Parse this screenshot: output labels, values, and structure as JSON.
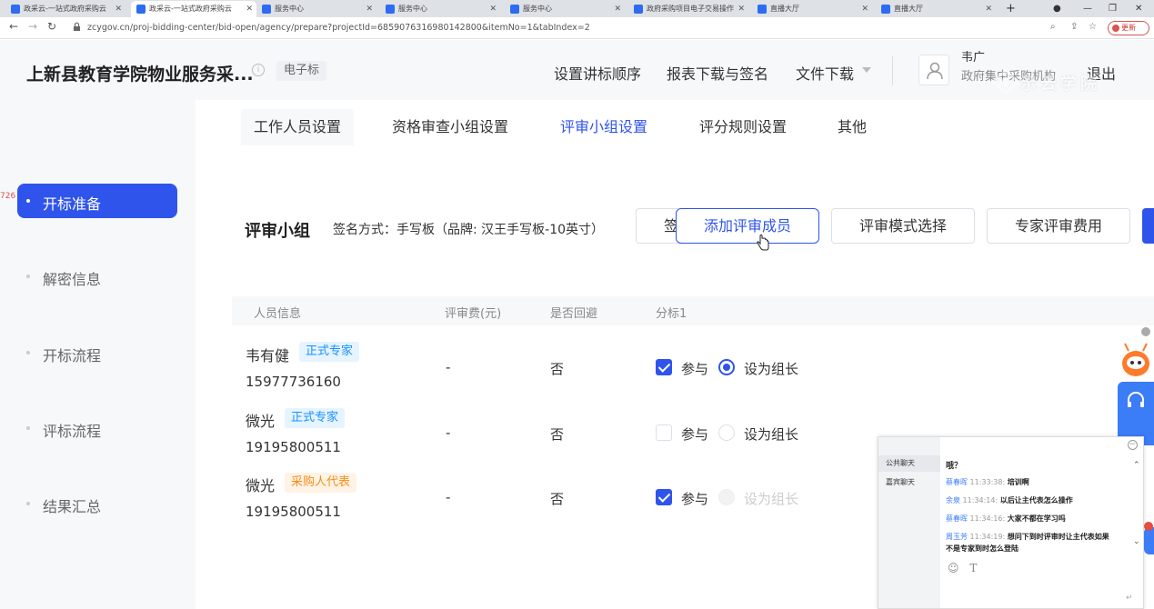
{
  "browser": {
    "tabs": [
      {
        "title": "政采云-一站式政府采购云"
      },
      {
        "title": "政采云-一站式政府采购云"
      },
      {
        "title": "服务中心"
      },
      {
        "title": "服务中心"
      },
      {
        "title": "服务中心"
      },
      {
        "title": "政府采购项目电子交易操作"
      },
      {
        "title": "直播大厅"
      },
      {
        "title": "直播大厅"
      }
    ],
    "url": "zcygov.cn/proj-bidding-center/bid-open/agency/prepare?projectId=6859076316980142800&itemNo=1&tabIndex=2",
    "update_label": "更新",
    "new_tab_label": "+"
  },
  "header": {
    "project_title": "上新县教育学院物业服务采...",
    "type_tag": "电子标",
    "nav": [
      "设置讲标顺序",
      "报表下载与签名",
      "文件下载"
    ],
    "user_name": "韦广",
    "user_org": "政府集中采购机构",
    "logout": "退出",
    "watermark": "示云学院"
  },
  "sidebar": {
    "edge_text": "726",
    "items": [
      {
        "label": "开标准备",
        "active": true
      },
      {
        "label": "解密信息"
      },
      {
        "label": "开标流程"
      },
      {
        "label": "评标流程"
      },
      {
        "label": "结果汇总"
      }
    ]
  },
  "subtabs": [
    "工作人员设置",
    "资格审查小组设置",
    "评审小组设置",
    "评分规则设置",
    "其他"
  ],
  "panel": {
    "title": "评审小组",
    "sign_method": "签名方式：手写板（品牌: 汉王手写板-10英寸）",
    "buttons": {
      "partial": "签",
      "add_member": "添加评审成员",
      "mode_select": "评审模式选择",
      "expert_fee": "专家评审费用"
    }
  },
  "table": {
    "headers": [
      "人员信息",
      "评审费(元)",
      "是否回避",
      "分标1"
    ],
    "rows": [
      {
        "name": "韦有健",
        "role": "正式专家",
        "role_type": "blue",
        "phone": "15977736160",
        "fee": "-",
        "avoid": "否",
        "participate": true,
        "participate_label": "参与",
        "leader_label": "设为组长",
        "leader": "on"
      },
      {
        "name": "微光",
        "role": "正式专家",
        "role_type": "blue",
        "phone": "19195800511",
        "fee": "-",
        "avoid": "否",
        "participate": false,
        "participate_label": "参与",
        "leader_label": "设为组长",
        "leader": "off"
      },
      {
        "name": "微光",
        "role": "采购人代表",
        "role_type": "orange",
        "phone": "19195800511",
        "fee": "-",
        "avoid": "否",
        "participate": true,
        "participate_label": "参与",
        "leader_label": "设为组长",
        "leader": "disabled"
      }
    ]
  },
  "chat": {
    "tabs": [
      "公共聊天",
      "嘉宾聊天"
    ],
    "top_message": "哦？",
    "messages": [
      {
        "who": "蔡春晖",
        "time": "11:33:38:",
        "text": "培训啊"
      },
      {
        "who": "余泉",
        "time": "11:34:14:",
        "text": "以后让主代表怎么操作"
      },
      {
        "who": "蔡春晖",
        "time": "11:34:16:",
        "text": "大家不都在学习吗"
      },
      {
        "who": "周玉芳",
        "time": "11:34:19:",
        "text": "想问下到时评审时让主代表如果"
      },
      {
        "who": "",
        "time": "",
        "text": "不是专家到时怎么登陆"
      }
    ],
    "tools": [
      "☺",
      "T"
    ]
  }
}
